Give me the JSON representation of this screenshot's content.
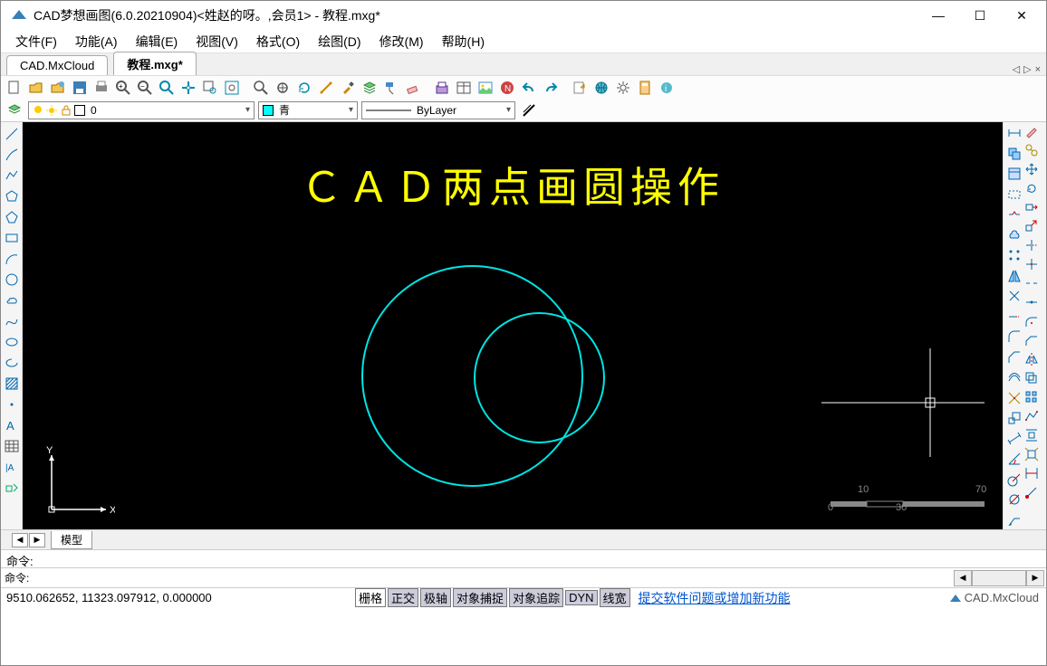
{
  "window": {
    "title": "CAD梦想画图(6.0.20210904)<姓赵的呀。,会员1> - 教程.mxg*",
    "min": "—",
    "max": "☐",
    "close": "✕"
  },
  "menu": {
    "file": "文件(F)",
    "func": "功能(A)",
    "edit": "编辑(E)",
    "view": "视图(V)",
    "format": "格式(O)",
    "draw": "绘图(D)",
    "modify": "修改(M)",
    "help": "帮助(H)"
  },
  "tabs": {
    "t1": "CAD.MxCloud",
    "t2": "教程.mxg*",
    "nav_l": "◁",
    "nav_r": "▷",
    "close": "×"
  },
  "layerbar": {
    "layer_value": "0",
    "color_value": "青",
    "lt_value": "ByLayer"
  },
  "canvas": {
    "heading": "ＣＡＤ两点画圆操作",
    "axis_x": "X",
    "axis_y": "Y"
  },
  "ruler": {
    "t0": "0",
    "t10": "10",
    "t30": "30",
    "t70": "70"
  },
  "bottom_tabs": {
    "prev": "◀",
    "next": "▶",
    "model": "模型"
  },
  "cmd": {
    "out": "命令:",
    "label": "命令:",
    "value": "",
    "scroll_l": "◀",
    "scroll_r": "▶"
  },
  "status": {
    "coords": "9510.062652,  11323.097912,  0.000000",
    "grid": "栅格",
    "ortho": "正交",
    "polar": "极轴",
    "osnap": "对象捕捉",
    "otrack": "对象追踪",
    "dyn": "DYN",
    "lw": "线宽",
    "link": "提交软件问题或增加新功能",
    "brand": "CAD.MxCloud"
  }
}
